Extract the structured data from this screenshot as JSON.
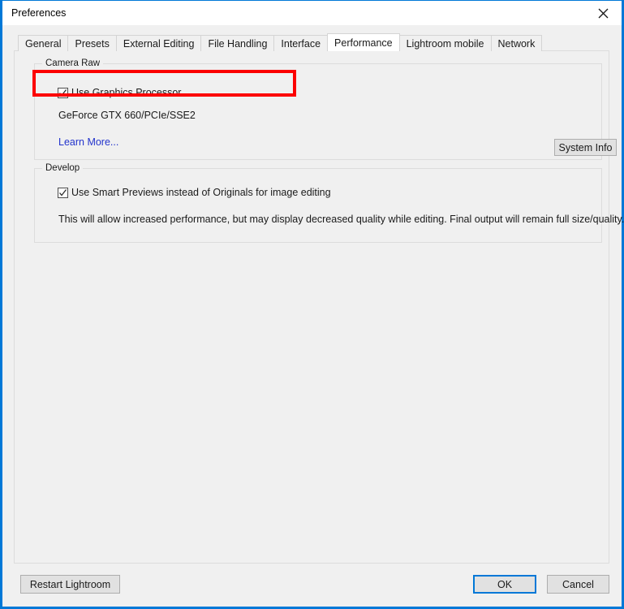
{
  "window": {
    "title": "Preferences",
    "close_icon": "close-icon",
    "accent_color": "#0078d7",
    "panel_background": "#f0f0f0"
  },
  "tabs": [
    {
      "label": "General",
      "active": false
    },
    {
      "label": "Presets",
      "active": false
    },
    {
      "label": "External Editing",
      "active": false
    },
    {
      "label": "File Handling",
      "active": false
    },
    {
      "label": "Interface",
      "active": false
    },
    {
      "label": "Performance",
      "active": true
    },
    {
      "label": "Lightroom mobile",
      "active": false
    },
    {
      "label": "Network",
      "active": false
    }
  ],
  "camera_raw": {
    "legend": "Camera Raw",
    "use_gpu_checkbox": {
      "label": "Use Graphics Processor",
      "checked": true
    },
    "gpu_name": "GeForce GTX 660/PCIe/SSE2",
    "learn_more_link": "Learn More...",
    "learn_more_color": "#2233cc",
    "system_info_button": "System Info"
  },
  "develop": {
    "legend": "Develop",
    "smart_previews_checkbox": {
      "label": "Use Smart Previews instead of Originals for image editing",
      "checked": true
    },
    "note": "This will allow increased performance, but may display decreased quality while editing. Final output will remain full size/quality."
  },
  "footer": {
    "restart_button": "Restart Lightroom",
    "ok_button": "OK",
    "cancel_button": "Cancel"
  },
  "annotation": {
    "highlight_color": "#fc0000",
    "target": "use-graphics-processor-row"
  }
}
